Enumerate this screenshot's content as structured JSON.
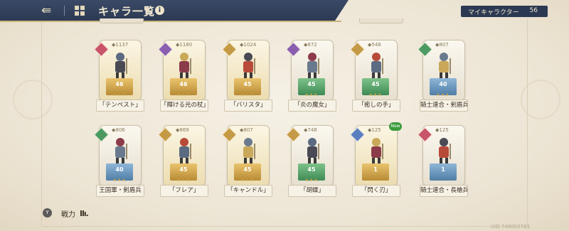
{
  "header": {
    "title": "キャラ一覧",
    "counter_label": "マイキャラクター",
    "counter_value": "56"
  },
  "colors": {
    "header_bg": "#2c3953",
    "accent_gold": "#c9b47a"
  },
  "icons": {
    "back": "back-arrow-icon",
    "grid": "grid-view-icon",
    "info": "info-icon"
  },
  "row1": [
    {
      "name": "「テンペスト」",
      "level": "46",
      "power": "1137",
      "rarity": "pink",
      "badge_color": "#c8556a",
      "pedestal": "gold",
      "stars": "★★★"
    },
    {
      "name": "「輝ける光の杖」",
      "level": "46",
      "power": "1180",
      "rarity": "purple",
      "badge_color": "#8a5fb0",
      "pedestal": "gold",
      "stars": "★★★"
    },
    {
      "name": "「バリスタ」",
      "level": "45",
      "power": "1024",
      "rarity": "gold",
      "badge_color": "#c59a46",
      "pedestal": "gold",
      "stars": "★★★"
    },
    {
      "name": "「炎の魔女」",
      "level": "45",
      "power": "872",
      "rarity": "purple",
      "badge_color": "#8a5fb0",
      "pedestal": "green",
      "stars": "★★★"
    },
    {
      "name": "「癒しの手」",
      "level": "45",
      "power": "548",
      "rarity": "gold",
      "badge_color": "#c59a46",
      "pedestal": "green",
      "stars": "★★★"
    },
    {
      "name": "騎士連合・剣盾兵",
      "level": "40",
      "power": "807",
      "rarity": "green",
      "badge_color": "#4c9a62",
      "pedestal": "blue",
      "stars": "★★★"
    }
  ],
  "row2": [
    {
      "name": "王国軍・剣盾兵",
      "level": "40",
      "power": "806",
      "rarity": "green",
      "badge_color": "#4c9a62",
      "pedestal": "blue",
      "stars": "★★★"
    },
    {
      "name": "「フレア」",
      "level": "45",
      "power": "869",
      "rarity": "gold",
      "badge_color": "#c59a46",
      "pedestal": "gold",
      "stars": "★★★"
    },
    {
      "name": "「キャンドル」",
      "level": "45",
      "power": "807",
      "rarity": "gold",
      "badge_color": "#c59a46",
      "pedestal": "gold",
      "stars": "★★★"
    },
    {
      "name": "「胡蝶」",
      "level": "45",
      "power": "748",
      "rarity": "gold",
      "badge_color": "#c59a46",
      "pedestal": "green",
      "stars": "★★★"
    },
    {
      "name": "「閃く刃」",
      "level": "1",
      "power": "125",
      "rarity": "blue",
      "badge_color": "#5a7fc0",
      "pedestal": "gold",
      "stars": "",
      "new": "New"
    },
    {
      "name": "騎士連合・長槍兵",
      "level": "1",
      "power": "125",
      "rarity": "pink",
      "badge_color": "#c8556a",
      "pedestal": "blue",
      "stars": ""
    }
  ],
  "footer": {
    "sort_key_icon": "Y",
    "label": "戦力",
    "bars": "Ilı."
  },
  "uid": "UID 748002783"
}
